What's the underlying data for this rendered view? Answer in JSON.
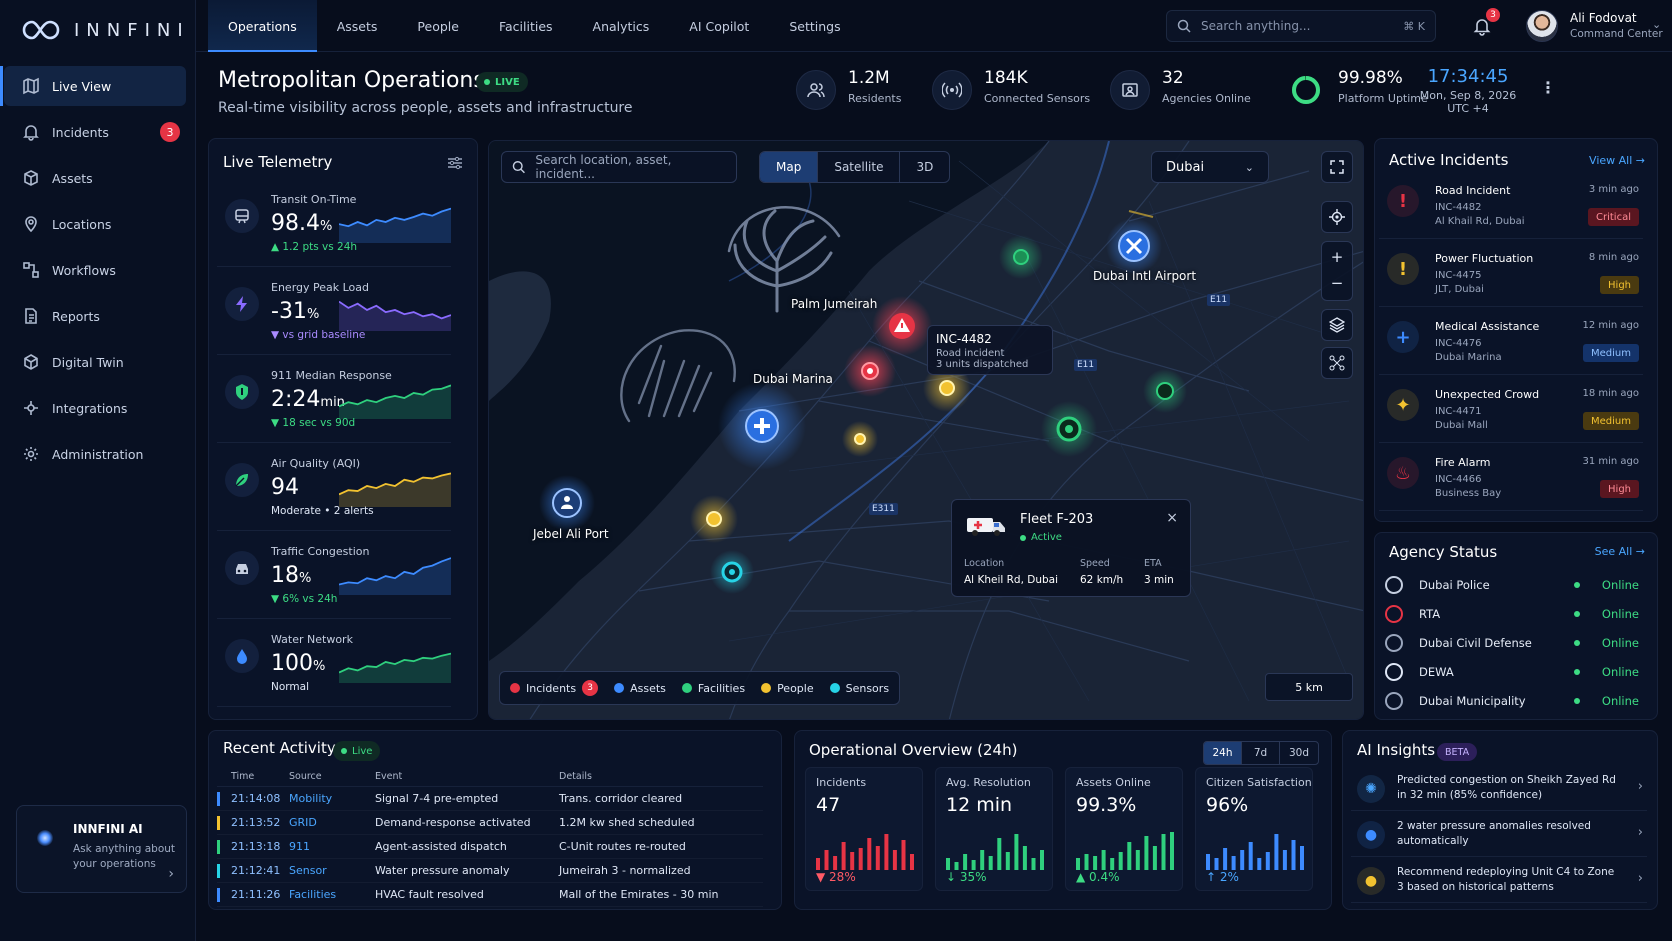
{
  "brand": {
    "name": "INNFINI"
  },
  "nav": [
    {
      "label": "Live View",
      "icon": "map-icon",
      "active": true
    },
    {
      "label": "Incidents",
      "icon": "bell-alert-icon",
      "badge": "3"
    },
    {
      "label": "Assets",
      "icon": "box-icon"
    },
    {
      "label": "Locations",
      "icon": "pin-icon"
    },
    {
      "label": "Workflows",
      "icon": "workflow-icon"
    },
    {
      "label": "Reports",
      "icon": "document-icon"
    },
    {
      "label": "Digital Twin",
      "icon": "cube-icon"
    },
    {
      "label": "Integrations",
      "icon": "integration-icon"
    },
    {
      "label": "Administration",
      "icon": "gear-icon"
    }
  ],
  "ai": {
    "title": "INNFINI AI",
    "subtitle": "Ask anything about your operations"
  },
  "tabs": [
    "Operations",
    "Assets",
    "People",
    "Facilities",
    "Analytics",
    "AI Copilot",
    "Settings"
  ],
  "search": {
    "placeholder": "Search anything...",
    "shortcut": "⌘ K"
  },
  "notifications": {
    "count": "3"
  },
  "user": {
    "name": "Ali Fodovat",
    "role": "Command Center"
  },
  "header": {
    "title": "Metropolitan Operations",
    "live": "LIVE",
    "subtitle": "Real-time visibility across people, assets and infrastructure"
  },
  "stats": [
    {
      "value": "1.2M",
      "label": "Residents"
    },
    {
      "value": "184K",
      "label": "Connected Sensors"
    },
    {
      "value": "32",
      "label": "Agencies Online"
    },
    {
      "value": "99.98%",
      "label": "Platform Uptime"
    }
  ],
  "clock": {
    "time": "17:34:45",
    "date": "Mon, Sep 8, 2026",
    "zone": "UTC +4"
  },
  "telemetry": {
    "title": "Live Telemetry",
    "items": [
      {
        "label": "Transit On-Time",
        "value": "98.4",
        "unit": "%",
        "sub": "▲ 1.2 pts vs 24h",
        "sub_color": "#3ddc84",
        "color": "#3d8bff"
      },
      {
        "label": "Energy Peak Load",
        "value": "-31",
        "unit": "%",
        "sub": "▼ vs grid baseline",
        "sub_color": "#a98bff",
        "color": "#8a6bff"
      },
      {
        "label": "911 Median Response",
        "value": "2:24",
        "unit": "min",
        "sub": "▼ 18 sec vs 90d",
        "sub_color": "#3ddc84",
        "color": "#2fd07e"
      },
      {
        "label": "Air Quality (AQI)",
        "value": "94",
        "unit": "",
        "sub": "Moderate  •  2 alerts",
        "sub_color": "#dfe7f6",
        "color": "#f2c230"
      },
      {
        "label": "Traffic Congestion",
        "value": "18",
        "unit": "%",
        "sub": "▼ 6% vs 24h",
        "sub_color": "#3ddc84",
        "color": "#3d8bff"
      },
      {
        "label": "Water Network",
        "value": "100",
        "unit": "%",
        "sub": "Normal",
        "sub_color": "#dfe7f6",
        "color": "#2fd07e"
      }
    ]
  },
  "map": {
    "search_placeholder": "Search location, asset, incident...",
    "views": [
      "Map",
      "Satellite",
      "3D"
    ],
    "city": "Dubai",
    "labels": {
      "palm": "Palm Jumeirah",
      "marina": "Dubai Marina",
      "airport": "Dubai Intl Airport",
      "port": "Jebel Ali Port"
    },
    "roads": [
      "E11",
      "E11",
      "E311"
    ],
    "incident": {
      "id": "INC-4482",
      "type": "Road incident",
      "units": "3 units dispatched"
    },
    "fleet": {
      "name": "Fleet F-203",
      "status": "Active",
      "location_label": "Location",
      "location": "Al Kheil Rd, Dubai",
      "speed_label": "Speed",
      "speed": "62 km/h",
      "eta_label": "ETA",
      "eta": "3 min"
    },
    "legend": [
      {
        "label": "Incidents",
        "color": "#e63445",
        "count": "3"
      },
      {
        "label": "Assets",
        "color": "#3d8bff"
      },
      {
        "label": "Facilities",
        "color": "#2fd07e"
      },
      {
        "label": "People",
        "color": "#f2c230"
      },
      {
        "label": "Sensors",
        "color": "#27d3e6"
      }
    ],
    "scale": "5 km"
  },
  "incidents": {
    "title": "Active Incidents",
    "link": "View All →",
    "items": [
      {
        "title": "Road Incident",
        "id": "INC-4482",
        "location": "Al Khail Rd, Dubai",
        "time": "3 min ago",
        "severity": "Critical",
        "sev_bg": "#5a1620",
        "sev_fg": "#ff8a95",
        "icon_color": "#e63445"
      },
      {
        "title": "Power Fluctuation",
        "id": "INC-4475",
        "location": "JLT, Dubai",
        "time": "8 min ago",
        "severity": "High",
        "sev_bg": "#4a3a10",
        "sev_fg": "#f2c230",
        "icon_color": "#f2c230"
      },
      {
        "title": "Medical Assistance",
        "id": "INC-4476",
        "location": "Dubai Marina",
        "time": "12 min ago",
        "severity": "Medium",
        "sev_bg": "#14336a",
        "sev_fg": "#8fc0ff",
        "icon_color": "#3d8bff"
      },
      {
        "title": "Unexpected Crowd",
        "id": "INC-4471",
        "location": "Dubai Mall",
        "time": "18 min ago",
        "severity": "Medium",
        "sev_bg": "#4a3a10",
        "sev_fg": "#f2c230",
        "icon_color": "#f2c230"
      },
      {
        "title": "Fire Alarm",
        "id": "INC-4466",
        "location": "Business Bay",
        "time": "31 min ago",
        "severity": "High",
        "sev_bg": "#5a1620",
        "sev_fg": "#ff8a95",
        "icon_color": "#e63445"
      }
    ]
  },
  "agencies": {
    "title": "Agency Status",
    "link": "See All →",
    "items": [
      {
        "name": "Dubai Police",
        "status": "Online"
      },
      {
        "name": "RTA",
        "status": "Online"
      },
      {
        "name": "Dubai Civil Defense",
        "status": "Online"
      },
      {
        "name": "DEWA",
        "status": "Online"
      },
      {
        "name": "Dubai Municipality",
        "status": "Online"
      }
    ]
  },
  "activity": {
    "title": "Recent Activity",
    "live": "Live",
    "columns": [
      "Time",
      "Source",
      "Event",
      "Details"
    ],
    "rows": [
      {
        "time": "21:14:08",
        "source": "Mobility",
        "event": "Signal 7-4 pre-empted",
        "details": "Trans. corridor cleared",
        "color": "#3d8bff"
      },
      {
        "time": "21:13:52",
        "source": "GRID",
        "event": "Demand-response activated",
        "details": "1.2M kw shed scheduled",
        "color": "#f2c230"
      },
      {
        "time": "21:13:18",
        "source": "911",
        "event": "Agent-assisted dispatch",
        "details": "C-Unit routes re-routed",
        "color": "#2fd07e"
      },
      {
        "time": "21:12:41",
        "source": "Sensor",
        "event": "Water pressure anomaly",
        "details": "Jumeirah 3 - normalized",
        "color": "#27d3e6"
      },
      {
        "time": "21:11:26",
        "source": "Facilities",
        "event": "HVAC fault resolved",
        "details": "Mall of the Emirates - 30 min",
        "color": "#3d8bff"
      }
    ]
  },
  "overview": {
    "title": "Operational Overview (24h)",
    "ranges": [
      "24h",
      "7d",
      "30d"
    ],
    "cards": [
      {
        "label": "Incidents",
        "value": "47",
        "delta": "▼ 28%",
        "delta_color": "#ff5a66",
        "bar_color": "#e63445",
        "bars": [
          0.3,
          0.5,
          0.35,
          0.7,
          0.45,
          0.55,
          0.8,
          0.6,
          0.9,
          0.5,
          0.75,
          0.4
        ]
      },
      {
        "label": "Avg. Resolution",
        "value": "12 min",
        "delta": "↓ 35%",
        "delta_color": "#3ddc84",
        "bar_color": "#2fd07e",
        "bars": [
          0.3,
          0.2,
          0.4,
          0.25,
          0.5,
          0.35,
          0.8,
          0.45,
          0.9,
          0.6,
          0.3,
          0.5
        ]
      },
      {
        "label": "Assets Online",
        "value": "99.3%",
        "delta": "▲ 0.4%",
        "delta_color": "#3ddc84",
        "bar_color": "#2fd07e",
        "bars": [
          0.3,
          0.4,
          0.35,
          0.5,
          0.3,
          0.45,
          0.7,
          0.5,
          0.85,
          0.6,
          0.9,
          0.95
        ]
      },
      {
        "label": "Citizen Satisfaction",
        "value": "96%",
        "delta": "↑ 2%",
        "delta_color": "#4aa6ff",
        "bar_color": "#3d8bff",
        "bars": [
          0.4,
          0.3,
          0.55,
          0.35,
          0.5,
          0.7,
          0.3,
          0.45,
          0.9,
          0.5,
          0.75,
          0.6
        ]
      }
    ]
  },
  "insights": {
    "title": "AI Insights",
    "badge": "BETA",
    "items": [
      {
        "text": "Predicted congestion on Sheikh Zayed Rd in 32 min (85% confidence)",
        "icon": "sun-icon",
        "color": "#4aa6ff"
      },
      {
        "text": "2 water pressure anomalies resolved automatically",
        "icon": "drop-icon",
        "color": "#3d8bff"
      },
      {
        "text": "Recommend redeploying Unit C4 to Zone 3 based on historical patterns",
        "icon": "bulb-icon",
        "color": "#f2c230"
      }
    ]
  }
}
